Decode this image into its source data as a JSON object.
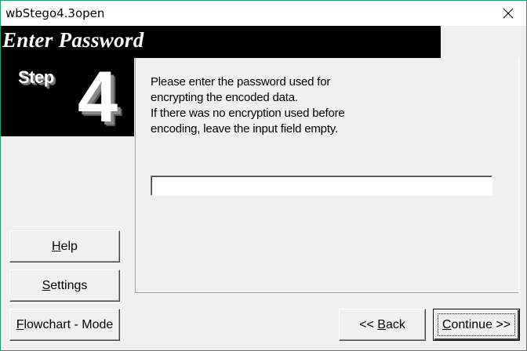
{
  "window": {
    "title": "wbStego4.3open",
    "close_icon": "close-icon"
  },
  "header": {
    "title": "Enter Password"
  },
  "step": {
    "label": "Step",
    "number": "4"
  },
  "instructions": [
    "Please enter the password used for",
    "encrypting the encoded data.",
    "If there was no encryption used before",
    "encoding, leave the input field empty."
  ],
  "password": {
    "value": "",
    "placeholder": ""
  },
  "buttons": {
    "help": {
      "mnemonic": "H",
      "rest": "elp"
    },
    "settings": {
      "mnemonic": "S",
      "rest": "ettings"
    },
    "flowchart": {
      "mnemonic": "F",
      "rest": "lowchart - Mode"
    },
    "back": {
      "prefix": "<< ",
      "mnemonic": "B",
      "rest": "ack"
    },
    "continue": {
      "mnemonic": "C",
      "rest": "ontinue >>"
    }
  }
}
